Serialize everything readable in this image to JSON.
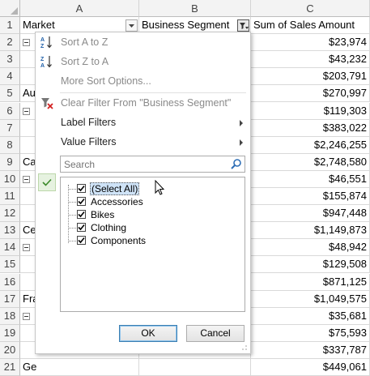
{
  "columns": [
    "A",
    "B",
    "C"
  ],
  "rows": [
    "1",
    "2",
    "3",
    "4",
    "5",
    "6",
    "7",
    "8",
    "9",
    "10",
    "11",
    "12",
    "13",
    "14",
    "15",
    "16",
    "17",
    "18",
    "19",
    "20",
    "21"
  ],
  "header": {
    "market": "Market",
    "segment": "Business Segment",
    "sum": "Sum of Sales Amount"
  },
  "left_cells": {
    "r5": "Au",
    "r9": "Ca",
    "r13": "Ce",
    "r17": "Fra",
    "r21": "Ge"
  },
  "values": [
    "$23,974",
    "$43,232",
    "$203,791",
    "$270,997",
    "$119,303",
    "$383,022",
    "$2,246,255",
    "$2,748,580",
    "$46,551",
    "$155,874",
    "$947,448",
    "$1,149,873",
    "$48,942",
    "$129,508",
    "$871,125",
    "$1,049,575",
    "$35,681",
    "$75,593",
    "$337,787",
    "$449,061"
  ],
  "menu": {
    "sort_az": "Sort A to Z",
    "sort_za": "Sort Z to A",
    "more_sort": "More Sort Options...",
    "clear_filter": "Clear Filter From \"Business Segment\"",
    "label_filters": "Label Filters",
    "value_filters": "Value Filters",
    "search_placeholder": "Search",
    "items": [
      {
        "label": "(Select All)",
        "checked": true,
        "selected": true
      },
      {
        "label": "Accessories",
        "checked": true
      },
      {
        "label": "Bikes",
        "checked": true
      },
      {
        "label": "Clothing",
        "checked": true
      },
      {
        "label": "Components",
        "checked": true
      }
    ],
    "ok": "OK",
    "cancel": "Cancel"
  },
  "colors": {
    "accent": "#3c7fb1",
    "selection": "#cfe3f7",
    "sort_icon_blue": "#1f5fa8",
    "filter_red": "#d32020"
  },
  "icons": [
    "sort-ascending-icon",
    "sort-descending-icon",
    "clear-filter-icon",
    "filter-dropdown-icon",
    "dropdown-arrow-icon",
    "search-icon",
    "checkmark-icon",
    "collapse-icon",
    "resize-grip-icon",
    "mouse-cursor-icon"
  ]
}
